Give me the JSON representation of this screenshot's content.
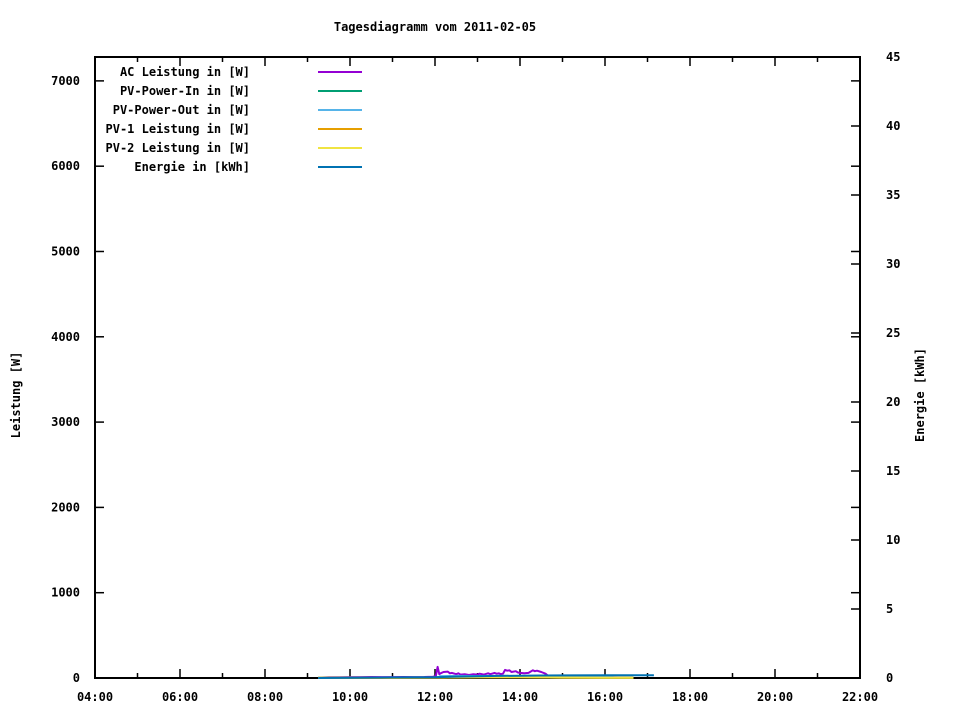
{
  "chart_data": {
    "type": "line",
    "title": "Tagesdiagramm vom 2011-02-05",
    "ylabel": "Leistung [W]",
    "y2label": "Energie [kWh]",
    "grid": false,
    "legend_position": "top-left-inside",
    "x_axis": {
      "min": 4,
      "max": 22,
      "major_ticks": [
        4,
        6,
        8,
        10,
        12,
        14,
        16,
        18,
        20,
        22
      ],
      "major_tick_labels": [
        "04:00",
        "06:00",
        "08:00",
        "10:00",
        "12:00",
        "14:00",
        "16:00",
        "18:00",
        "20:00",
        "22:00"
      ],
      "minor_ticks": [
        5,
        7,
        9,
        11,
        13,
        15,
        17,
        19,
        21
      ]
    },
    "y_axis": {
      "min": 0,
      "max": 7280,
      "ticks": [
        0,
        1000,
        2000,
        3000,
        4000,
        5000,
        6000,
        7000
      ],
      "tick_labels": [
        "0",
        "1000",
        "2000",
        "3000",
        "4000",
        "5000",
        "6000",
        "7000"
      ]
    },
    "y2_axis": {
      "min": 0,
      "max": 45,
      "ticks": [
        0,
        5,
        10,
        15,
        20,
        25,
        30,
        35,
        40,
        45
      ],
      "tick_labels": [
        "0",
        "5",
        "10",
        "15",
        "20",
        "25",
        "30",
        "35",
        "40",
        "45"
      ]
    },
    "legend": [
      {
        "label": "AC Leistung in [W]",
        "color": "#9400d3"
      },
      {
        "label": "PV-Power-In in [W]",
        "color": "#009e73"
      },
      {
        "label": "PV-Power-Out in [W]",
        "color": "#56b4e9"
      },
      {
        "label": "PV-1 Leistung in [W]",
        "color": "#e69f00"
      },
      {
        "label": "PV-2 Leistung in [W]",
        "color": "#f0e442"
      },
      {
        "label": "Energie in [kWh]",
        "color": "#0072b2"
      }
    ],
    "series": [
      {
        "name": "AC Leistung in [W]",
        "color": "#9400d3",
        "axis": "y",
        "points": [
          [
            9.25,
            5
          ],
          [
            9.5,
            8
          ],
          [
            9.75,
            8
          ],
          [
            10,
            10
          ],
          [
            10.25,
            10
          ],
          [
            10.5,
            12
          ],
          [
            10.75,
            10
          ],
          [
            11,
            10
          ],
          [
            11.25,
            12
          ],
          [
            11.5,
            10
          ],
          [
            11.75,
            12
          ],
          [
            11.95,
            15
          ],
          [
            12.02,
            20
          ],
          [
            12.06,
            130
          ],
          [
            12.1,
            45
          ],
          [
            12.15,
            60
          ],
          [
            12.2,
            70
          ],
          [
            12.3,
            75
          ],
          [
            12.35,
            55
          ],
          [
            12.4,
            60
          ],
          [
            12.5,
            45
          ],
          [
            12.55,
            55
          ],
          [
            12.6,
            40
          ],
          [
            12.7,
            45
          ],
          [
            12.8,
            35
          ],
          [
            12.9,
            45
          ],
          [
            13,
            40
          ],
          [
            13.05,
            50
          ],
          [
            13.15,
            40
          ],
          [
            13.25,
            55
          ],
          [
            13.3,
            45
          ],
          [
            13.4,
            60
          ],
          [
            13.45,
            50
          ],
          [
            13.5,
            55
          ],
          [
            13.55,
            45
          ],
          [
            13.6,
            50
          ],
          [
            13.65,
            95
          ],
          [
            13.7,
            85
          ],
          [
            13.75,
            90
          ],
          [
            13.8,
            70
          ],
          [
            13.9,
            80
          ],
          [
            13.95,
            65
          ],
          [
            14,
            60
          ],
          [
            14.1,
            55
          ],
          [
            14.2,
            60
          ],
          [
            14.3,
            90
          ],
          [
            14.35,
            80
          ],
          [
            14.4,
            85
          ],
          [
            14.5,
            70
          ],
          [
            14.6,
            50
          ],
          [
            14.65,
            30
          ],
          [
            14.7,
            15
          ],
          [
            14.8,
            12
          ],
          [
            14.9,
            10
          ],
          [
            15,
            12
          ],
          [
            15.1,
            10
          ],
          [
            15.2,
            15
          ],
          [
            15.3,
            12
          ],
          [
            15.35,
            18
          ],
          [
            15.45,
            12
          ],
          [
            15.5,
            15
          ],
          [
            15.6,
            10
          ],
          [
            15.7,
            12
          ],
          [
            15.8,
            8
          ],
          [
            15.9,
            10
          ],
          [
            16.1,
            8
          ],
          [
            16.3,
            6
          ],
          [
            16.5,
            5
          ],
          [
            16.67,
            4
          ]
        ]
      },
      {
        "name": "PV-Power-In in [W]",
        "color": "#009e73",
        "axis": "y",
        "points": [
          [
            9.25,
            3
          ],
          [
            10,
            5
          ],
          [
            11,
            6
          ],
          [
            12,
            8
          ],
          [
            12.5,
            18
          ],
          [
            13,
            15
          ],
          [
            13.5,
            20
          ],
          [
            14,
            18
          ],
          [
            14.5,
            15
          ],
          [
            15,
            8
          ],
          [
            15.5,
            6
          ],
          [
            16,
            5
          ],
          [
            16.67,
            3
          ]
        ]
      },
      {
        "name": "PV-Power-Out in [W]",
        "color": "#56b4e9",
        "axis": "y",
        "points": [
          [
            12.1,
            22
          ],
          [
            12.5,
            25
          ],
          [
            13,
            24
          ],
          [
            13.5,
            25
          ],
          [
            14,
            24
          ],
          [
            14.5,
            25
          ],
          [
            14.7,
            22
          ],
          [
            15,
            20
          ],
          [
            15.5,
            20
          ],
          [
            16,
            18
          ],
          [
            16.2,
            18
          ]
        ]
      },
      {
        "name": "PV-1 Leistung in [W]",
        "color": "#e69f00",
        "axis": "y",
        "points": [
          [
            9.25,
            2
          ],
          [
            10,
            3
          ],
          [
            11,
            4
          ],
          [
            12,
            5
          ],
          [
            13,
            8
          ],
          [
            14,
            8
          ],
          [
            15,
            5
          ],
          [
            16,
            3
          ],
          [
            16.67,
            2
          ]
        ]
      },
      {
        "name": "PV-2 Leistung in [W]",
        "color": "#f0e442",
        "axis": "y",
        "points": [
          [
            9.25,
            2
          ],
          [
            10,
            3
          ],
          [
            11,
            4
          ],
          [
            12,
            5
          ],
          [
            13,
            8
          ],
          [
            14,
            8
          ],
          [
            15,
            5
          ],
          [
            16,
            3
          ],
          [
            16.67,
            2
          ]
        ]
      },
      {
        "name": "Energie in [kWh]",
        "color": "#0072b2",
        "axis": "y2",
        "points": [
          [
            9.25,
            0
          ],
          [
            10,
            0.02
          ],
          [
            11,
            0.04
          ],
          [
            12,
            0.06
          ],
          [
            12.5,
            0.1
          ],
          [
            13,
            0.13
          ],
          [
            13.5,
            0.15
          ],
          [
            14,
            0.17
          ],
          [
            14.5,
            0.18
          ],
          [
            15,
            0.19
          ],
          [
            16,
            0.2
          ],
          [
            17,
            0.2
          ],
          [
            17.15,
            0.2
          ]
        ]
      }
    ]
  }
}
